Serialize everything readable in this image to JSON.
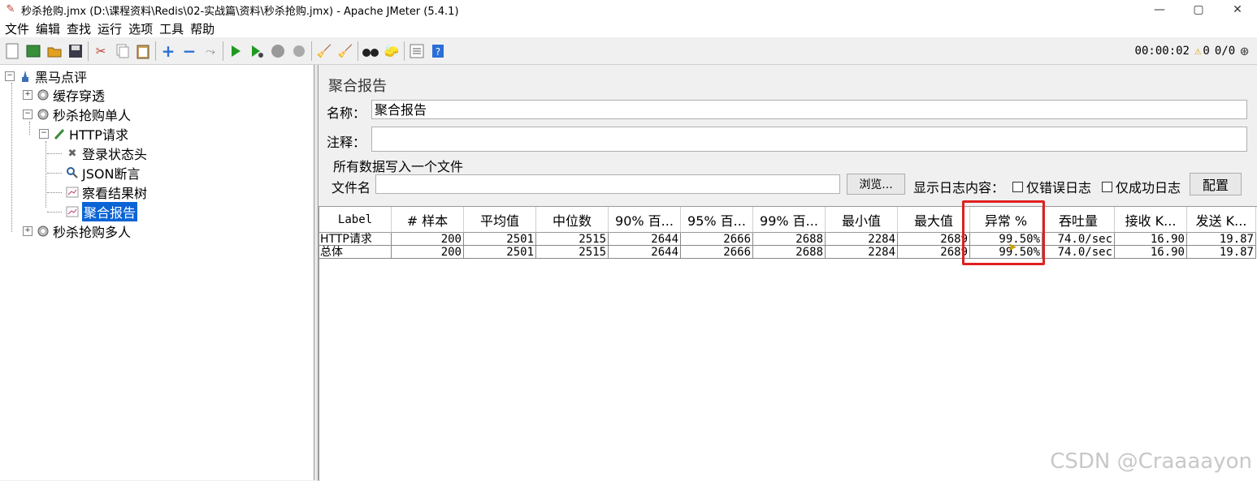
{
  "window": {
    "title": "秒杀抢购.jmx (D:\\课程资料\\Redis\\02-实战篇\\资料\\秒杀抢购.jmx) - Apache JMeter (5.4.1)",
    "minimize": "—",
    "maximize": "▢",
    "close": "✕"
  },
  "menu": [
    "文件",
    "编辑",
    "查找",
    "运行",
    "选项",
    "工具",
    "帮助"
  ],
  "toolbar": {
    "icons": [
      "new-icon",
      "templates-icon",
      "open-icon",
      "save-icon",
      "cut-icon",
      "copy-icon",
      "paste-icon",
      "expand-icon",
      "collapse-icon",
      "toggle-icon",
      "start-icon",
      "start-no-pause-icon",
      "stop-icon",
      "shutdown-icon",
      "clear-icon",
      "clear-all-icon",
      "search-icon",
      "reset-search-icon",
      "function-helper-icon",
      "help-icon"
    ],
    "timer": "00:00:02",
    "warnings": "0",
    "threads": "0/0"
  },
  "tree": {
    "root": "黑马点评",
    "items": {
      "cache": "缓存穿透",
      "single": "秒杀抢购单人",
      "http": "HTTP请求",
      "header": "登录状态头",
      "json": "JSON断言",
      "results_tree": "察看结果树",
      "aggregate": "聚合报告",
      "multi": "秒杀抢购多人"
    }
  },
  "panel": {
    "title": "聚合报告",
    "name_label": "名称：",
    "name_value": "聚合报告",
    "comment_label": "注释：",
    "comment_value": "",
    "file_section": "所有数据写入一个文件",
    "filename_label": "文件名",
    "filename_value": "",
    "browse_button": "浏览...",
    "log_content_label": "显示日志内容：",
    "errors_only": "仅错误日志",
    "success_only": "仅成功日志",
    "config_button": "配置"
  },
  "table": {
    "headers": [
      "Label",
      "# 样本",
      "平均值",
      "中位数",
      "90% 百...",
      "95% 百...",
      "99% 百...",
      "最小值",
      "最大值",
      "异常 %",
      "吞吐量",
      "接收 K...",
      "发送 K..."
    ],
    "rows": [
      [
        "HTTP请求",
        "200",
        "2501",
        "2515",
        "2644",
        "2666",
        "2688",
        "2284",
        "2689",
        "99.50%",
        "74.0/sec",
        "16.90",
        "19.87"
      ],
      [
        "总体",
        "200",
        "2501",
        "2515",
        "2644",
        "2666",
        "2688",
        "2284",
        "2689",
        "99.50%",
        "74.0/sec",
        "16.90",
        "19.87"
      ]
    ]
  },
  "watermark": "CSDN @Craaaayon"
}
